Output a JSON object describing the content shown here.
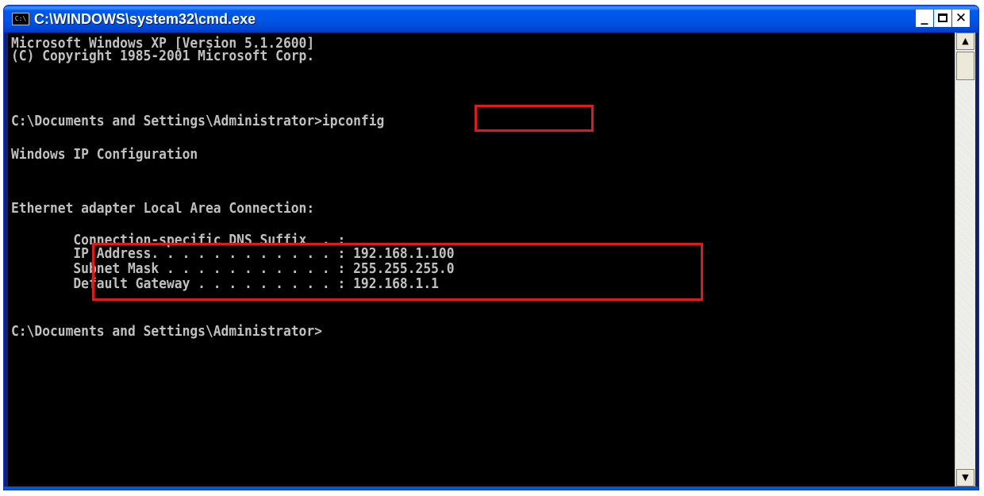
{
  "window": {
    "title": "C:\\WINDOWS\\system32\\cmd.exe",
    "icon": "cmd-icon",
    "icon_glyph": "C:\\",
    "controls": {
      "minimize": "_",
      "close": "✕"
    }
  },
  "console": {
    "lines": [
      "Microsoft Windows XP [Version 5.1.2600]",
      "(C) Copyright 1985-2001 Microsoft Corp.",
      "",
      "C:\\Documents and Settings\\Administrator>ipconfig",
      "",
      "Windows IP Configuration",
      "",
      "",
      "Ethernet adapter Local Area Connection:",
      "",
      "        Connection-specific DNS Suffix  . :",
      "        IP Address. . . . . . . . . . . . : 192.168.1.100",
      "        Subnet Mask . . . . . . . . . . . : 255.255.255.0",
      "        Default Gateway . . . . . . . . . : 192.168.1.1",
      "",
      "C:\\Documents and Settings\\Administrator>"
    ]
  },
  "highlight_color": "#e0191c",
  "colors": {
    "titlebar": "#0055e5",
    "console_bg": "#000000",
    "console_text": "#c0c0c0"
  },
  "scrollbar": {
    "up_arrow": "▲",
    "down_arrow": "▼"
  }
}
